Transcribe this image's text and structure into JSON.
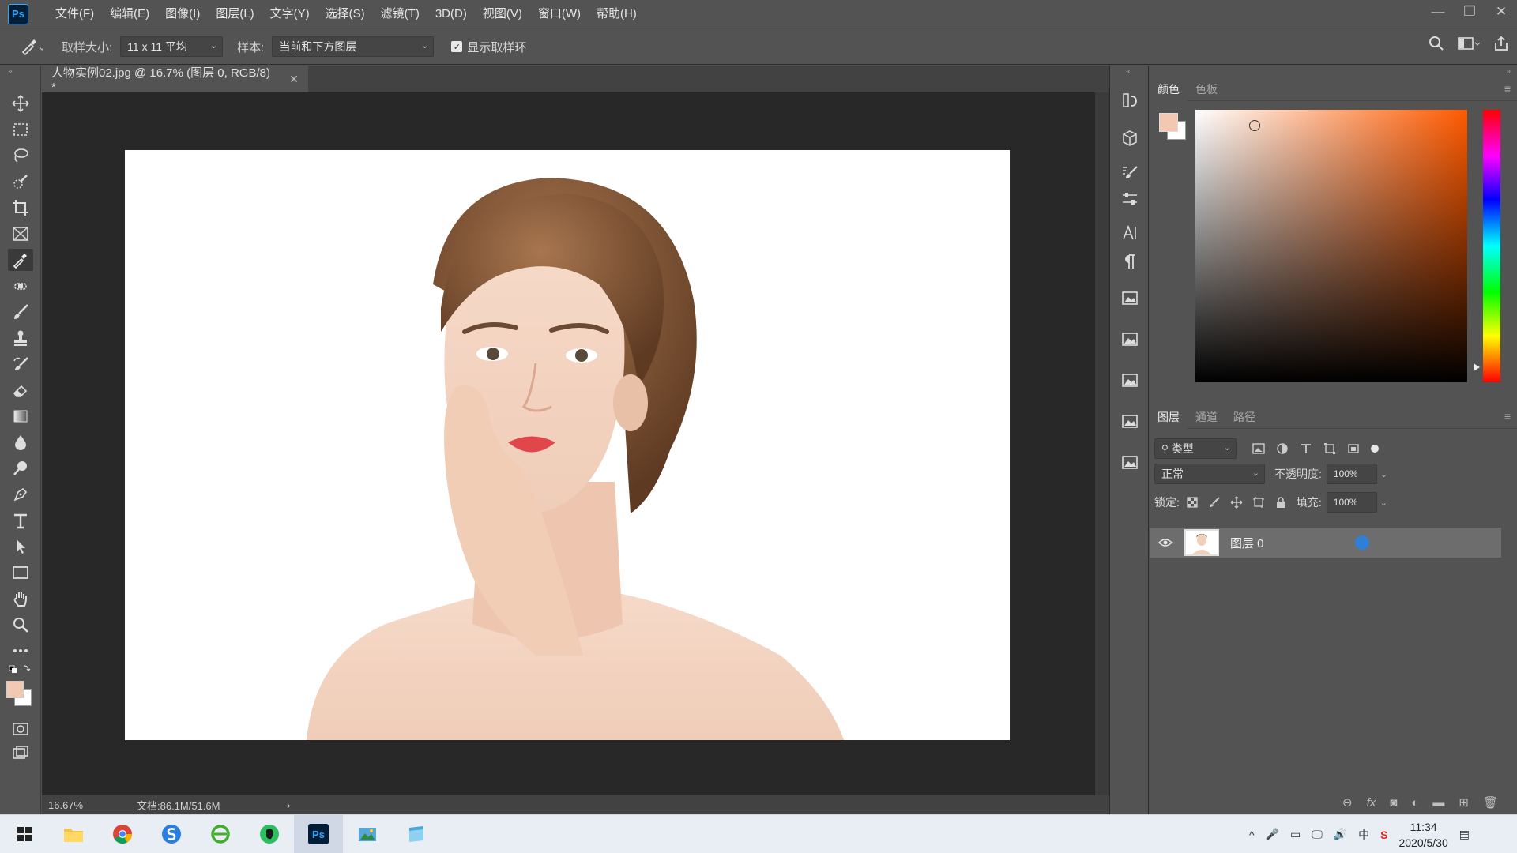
{
  "app": {
    "logo": "Ps"
  },
  "menu": [
    "文件(F)",
    "编辑(E)",
    "图像(I)",
    "图层(L)",
    "文字(Y)",
    "选择(S)",
    "滤镜(T)",
    "3D(D)",
    "视图(V)",
    "窗口(W)",
    "帮助(H)"
  ],
  "window_controls": {
    "minimize": "—",
    "restore": "❐",
    "close": "✕"
  },
  "options": {
    "tool_icon": "eyedropper-icon",
    "sample_size_label": "取样大小:",
    "sample_size_value": "11 x 11 平均",
    "sample_label": "样本:",
    "sample_value": "当前和下方图层",
    "show_ring_label": "显示取样环",
    "show_ring_checked": true
  },
  "document": {
    "tab_title": "人物实例02.jpg @ 16.7% (图层 0, RGB/8) *",
    "close": "✕"
  },
  "status": {
    "zoom": "16.67%",
    "doc_info": "文档:86.1M/51.6M",
    "arrow": "›"
  },
  "color_panel": {
    "tabs": [
      "颜色",
      "色板"
    ],
    "foreground": "#f2c8b2",
    "background": "#ffffff"
  },
  "layers_panel": {
    "tabs": [
      "图层",
      "通道",
      "路径"
    ],
    "filter_label": "类型",
    "blend_mode": "正常",
    "opacity_label": "不透明度:",
    "opacity_value": "100%",
    "lock_label": "锁定:",
    "fill_label": "填充:",
    "fill_value": "100%",
    "layers": [
      {
        "name": "图层 0",
        "visible": true
      }
    ]
  },
  "taskbar": {
    "time": "11:34",
    "date": "2020/5/30",
    "ime": "中"
  }
}
